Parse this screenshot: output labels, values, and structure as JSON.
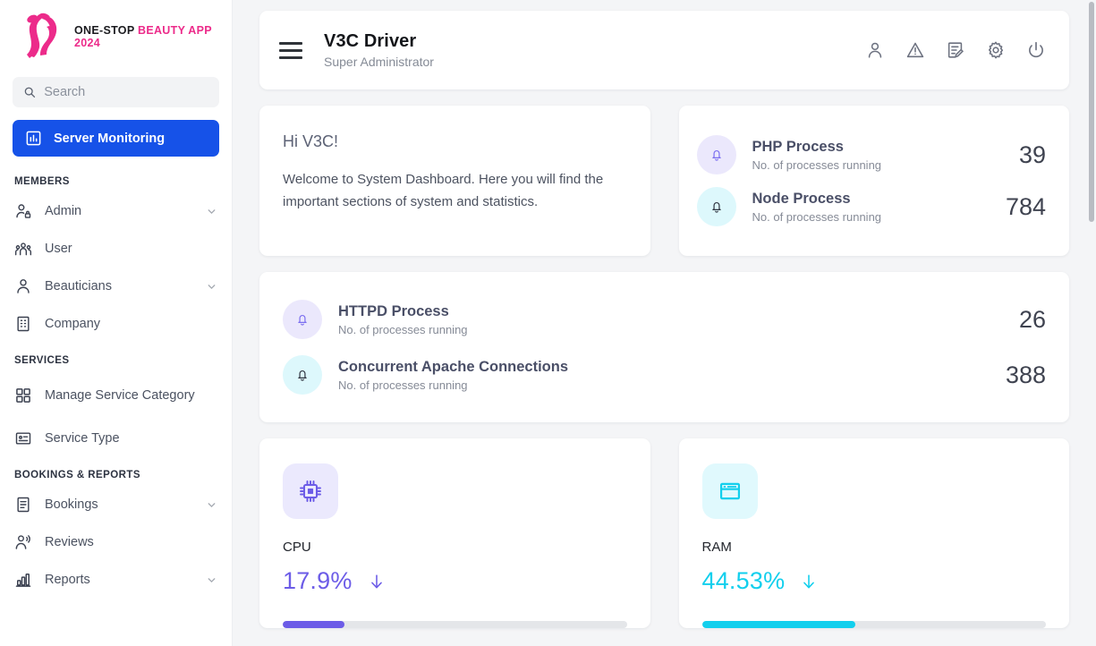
{
  "sidebar": {
    "logo": {
      "line1_dark": "ONE-STOP",
      "line1_pink": "BEAUTY APP",
      "line2": "2024",
      "icon": "beauty-woman-silhouette-logo"
    },
    "search": {
      "placeholder": "Search",
      "value": "",
      "icon": "search-icon"
    },
    "active_item": {
      "label": "Server Monitoring",
      "icon": "chart-bar-icon",
      "bg": "#1652e8"
    },
    "groups": [
      {
        "title": "MEMBERS",
        "items": [
          {
            "label": "Admin",
            "icon": "user-lock-icon",
            "expandable": true
          },
          {
            "label": "User",
            "icon": "users-group-icon",
            "expandable": false
          },
          {
            "label": "Beauticians",
            "icon": "person-icon",
            "expandable": true
          },
          {
            "label": "Company",
            "icon": "building-icon",
            "expandable": false
          }
        ]
      },
      {
        "title": "SERVICES",
        "items": [
          {
            "label": "Manage Service Category",
            "icon": "grid-squares-icon",
            "expandable": false
          },
          {
            "label": "Service Type",
            "icon": "id-card-icon",
            "expandable": false
          }
        ]
      },
      {
        "title": "BOOKINGS & REPORTS",
        "items": [
          {
            "label": "Bookings",
            "icon": "document-list-icon",
            "expandable": true
          },
          {
            "label": "Reviews",
            "icon": "person-voice-icon",
            "expandable": false
          },
          {
            "label": "Reports",
            "icon": "bar-chart-icon",
            "expandable": true
          }
        ]
      }
    ]
  },
  "topbar": {
    "menu_icon": "hamburger-menu-icon",
    "title": "V3C Driver",
    "subtitle": "Super Administrator",
    "icons": [
      {
        "name": "user-icon"
      },
      {
        "name": "warning-triangle-icon"
      },
      {
        "name": "edit-document-icon"
      },
      {
        "name": "gear-icon"
      },
      {
        "name": "power-icon"
      }
    ]
  },
  "welcome": {
    "greeting": "Hi V3C!",
    "message": "Welcome to System Dashboard. Here you will find the important sections of system and statistics."
  },
  "processes": {
    "top_card": [
      {
        "title": "PHP Process",
        "subtitle": "No. of processes running",
        "value": "39",
        "icon": "bell-icon",
        "bubble_color": "#ebe8fc",
        "icon_color": "#7b6ef0"
      },
      {
        "title": "Node Process",
        "subtitle": "No. of processes running",
        "value": "784",
        "icon": "bell-icon",
        "bubble_color": "#ddf8fc",
        "icon_color": "#2f3440"
      }
    ],
    "wide_card": [
      {
        "title": "HTTPD Process",
        "subtitle": "No. of processes running",
        "value": "26",
        "icon": "bell-icon",
        "bubble_color": "#ebe8fc",
        "icon_color": "#7b6ef0"
      },
      {
        "title": "Concurrent Apache Connections",
        "subtitle": "No. of processes running",
        "value": "388",
        "icon": "bell-icon",
        "bubble_color": "#ddf8fc",
        "icon_color": "#2f3440"
      }
    ]
  },
  "metrics": [
    {
      "name": "CPU",
      "value": "17.9%",
      "percent": 17.9,
      "trend": "down-arrow-icon",
      "icon": "cpu-chip-icon",
      "color": "#6c5ce7",
      "tile_bg": "#ebe9fd"
    },
    {
      "name": "RAM",
      "value": "44.53%",
      "percent": 44.53,
      "trend": "down-arrow-icon",
      "icon": "ram-window-icon",
      "color": "#12cfed",
      "tile_bg": "#e0f9fd"
    }
  ]
}
